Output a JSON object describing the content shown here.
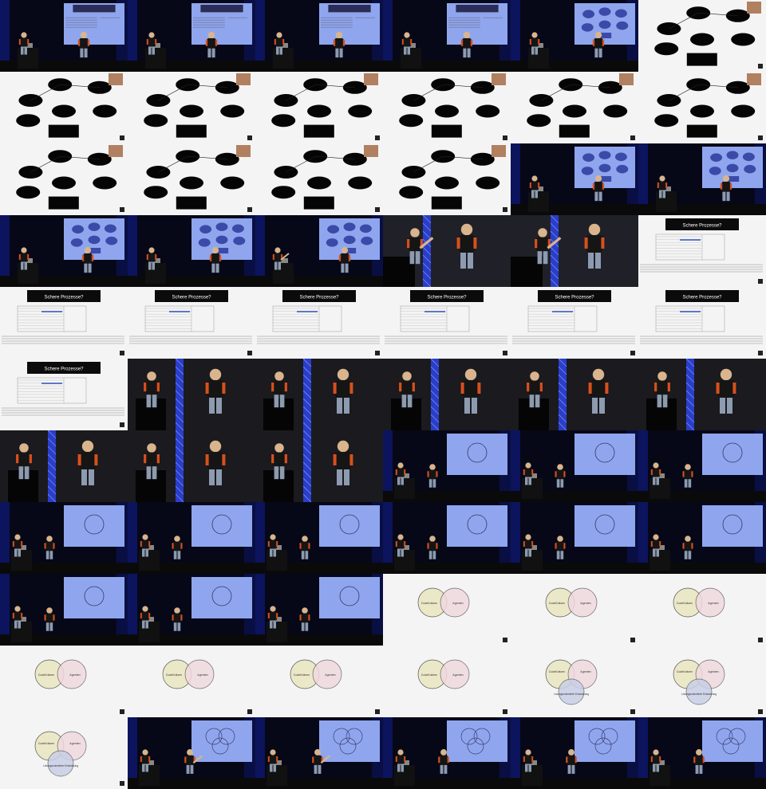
{
  "grid": {
    "columns": 6,
    "rows": 11
  },
  "frames": [
    "stage_table",
    "stage_table",
    "stage_table",
    "stage_table",
    "stage_ovals",
    "slide_ovals",
    "slide_ovals",
    "slide_ovals",
    "slide_ovals",
    "slide_ovals",
    "slide_ovals",
    "slide_ovals",
    "slide_ovals",
    "slide_ovals",
    "slide_ovals",
    "slide_ovals",
    "stage_ovals",
    "stage_ovals",
    "stage_ovals",
    "stage_ovals",
    "stage_ovals_point",
    "closeup_truss_point",
    "closeup_truss_point",
    "slide_table",
    "slide_table",
    "slide_table",
    "slide_table",
    "slide_table",
    "slide_table",
    "slide_table",
    "slide_table",
    "closeup_truss",
    "closeup_truss",
    "closeup_truss",
    "closeup_truss",
    "closeup_truss",
    "closeup_truss",
    "closeup_truss",
    "closeup_truss",
    "stage_circle1",
    "stage_circle1",
    "stage_circle1",
    "stage_circle1",
    "stage_circle1",
    "stage_circle1",
    "stage_circle1",
    "stage_circle1",
    "stage_circle1",
    "stage_circle1",
    "stage_circle1",
    "stage_circle1",
    "slide_venn2",
    "slide_venn2",
    "slide_venn2",
    "slide_venn2",
    "slide_venn2",
    "slide_venn2",
    "slide_venn2",
    "slide_venn3",
    "slide_venn3",
    "slide_venn3",
    "stage_venn3_point",
    "stage_venn3_point",
    "stage_venn3",
    "stage_venn3",
    "stage_venn3"
  ],
  "slides": {
    "table_title": "Schere Prozesse?",
    "venn_left": "Codeßnitzen",
    "venn_right": "Agenten",
    "venn_bottom": "Lösungsorientierte Entwicklung"
  },
  "colors": {
    "stage_bg": "#060818",
    "screen_blue": "#8fa6ee",
    "slide_white": "#f4f4f4",
    "venn_left": "#ebe8c8",
    "venn_right": "#f0d9e0",
    "venn_bottom": "#c9cfe6",
    "shirt_accent": "#d8501c"
  }
}
